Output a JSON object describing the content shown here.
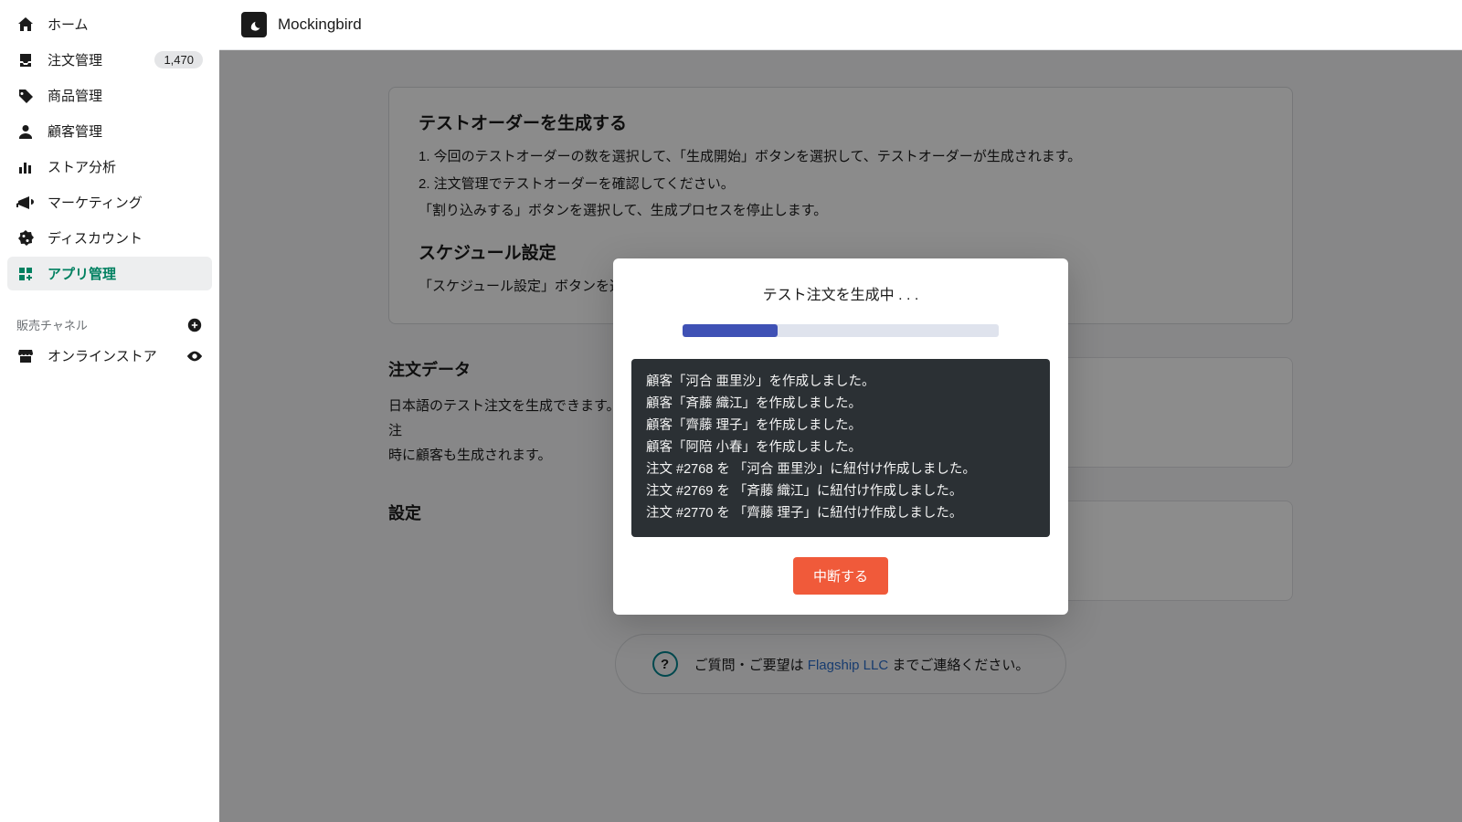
{
  "sidebar": {
    "items": [
      {
        "label": "ホーム"
      },
      {
        "label": "注文管理",
        "badge": "1,470"
      },
      {
        "label": "商品管理"
      },
      {
        "label": "顧客管理"
      },
      {
        "label": "ストア分析"
      },
      {
        "label": "マーケティング"
      },
      {
        "label": "ディスカウント"
      },
      {
        "label": "アプリ管理"
      }
    ],
    "sales_channel_header": "販売チャネル",
    "channels": [
      {
        "label": "オンラインストア"
      }
    ]
  },
  "topbar": {
    "app_name": "Mockingbird"
  },
  "main": {
    "intro": {
      "heading1": "テストオーダーを生成する",
      "step1": "1. 今回のテストオーダーの数を選択して、「生成開始」ボタンを選択して、テストオーダーが生成されます。",
      "step2": "2. 注文管理でテストオーダーを確認してください。",
      "step2b": "「割り込みする」ボタンを選択して、生成プロセスを停止します。",
      "heading2": "スケジュール設定",
      "schedule_desc": "「スケジュール設定」ボタンを選択して、ご希望の時間と時間帯をお選びください。"
    },
    "order_data": {
      "heading": "注文データ",
      "desc_a": "日本語のテスト注文を生成できます。注",
      "desc_b": "時に顧客も生成されます。"
    },
    "settings": {
      "heading": "設定"
    },
    "footer": {
      "prefix": "ご質問・ご要望は ",
      "link": "Flagship LLC",
      "suffix": " までご連絡ください。"
    }
  },
  "modal": {
    "title": "テスト注文を生成中 . . .",
    "progress_percent": 30,
    "log": [
      "顧客「河合 亜里沙」を作成しました。",
      "顧客「斉藤 織江」を作成しました。",
      "顧客「齊藤 理子」を作成しました。",
      "顧客「阿陪 小春」を作成しました。",
      "注文 #2768 を 「河合 亜里沙」に紐付け作成しました。",
      "注文 #2769 を 「斉藤 織江」に紐付け作成しました。",
      "注文 #2770 を 「齊藤 理子」に紐付け作成しました。"
    ],
    "cancel_label": "中断する"
  }
}
